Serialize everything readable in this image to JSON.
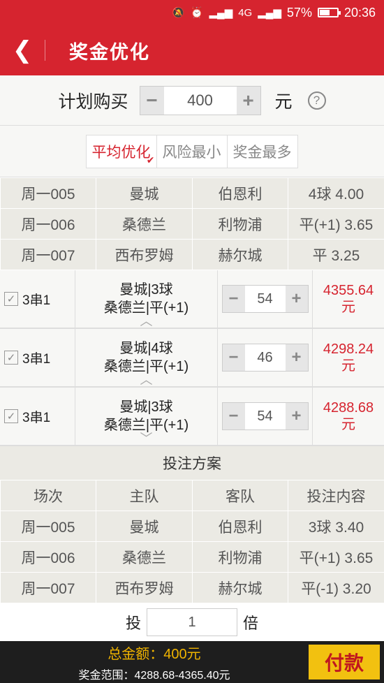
{
  "status": {
    "battery": "57%",
    "time": "20:36",
    "network": "4G"
  },
  "header": {
    "back": "❮",
    "title": "奖金优化"
  },
  "plan": {
    "label": "计划购买",
    "value": "400",
    "unit": "元",
    "help": "?"
  },
  "tabs": [
    {
      "label": "平均优化"
    },
    {
      "label": "风险最小"
    },
    {
      "label": "奖金最多"
    }
  ],
  "matches": [
    [
      "周一005",
      "曼城",
      "伯恩利",
      "4球 4.00"
    ],
    [
      "周一006",
      "桑德兰",
      "利物浦",
      "平(+1) 3.65"
    ],
    [
      "周一007",
      "西布罗姆",
      "赫尔城",
      "平 3.25"
    ]
  ],
  "combos": [
    {
      "type": "3串1",
      "line1": "曼城|3球",
      "line2": "桑德兰|平(+1)",
      "count": "54",
      "prize": "4355.64",
      "unit": "元",
      "chevron": "︿"
    },
    {
      "type": "3串1",
      "line1": "曼城|4球",
      "line2": "桑德兰|平(+1)",
      "count": "46",
      "prize": "4298.24",
      "unit": "元",
      "chevron": "︿"
    },
    {
      "type": "3串1",
      "line1": "曼城|3球",
      "line2": "桑德兰|平(+1)",
      "count": "54",
      "prize": "4288.68",
      "unit": "元",
      "chevron": "﹀"
    }
  ],
  "scheme": {
    "title": "投注方案",
    "headers": [
      "场次",
      "主队",
      "客队",
      "投注内容"
    ],
    "rows": [
      [
        "周一005",
        "曼城",
        "伯恩利",
        "3球 3.40"
      ],
      [
        "周一006",
        "桑德兰",
        "利物浦",
        "平(+1) 3.65"
      ],
      [
        "周一007",
        "西布罗姆",
        "赫尔城",
        "平(-1) 3.20"
      ]
    ]
  },
  "multiple": {
    "prefix": "投",
    "value": "1",
    "suffix": "倍"
  },
  "footer": {
    "total": "总金额：400元",
    "range": "奖金范围：4288.68-4365.40元",
    "pay": "付款"
  }
}
